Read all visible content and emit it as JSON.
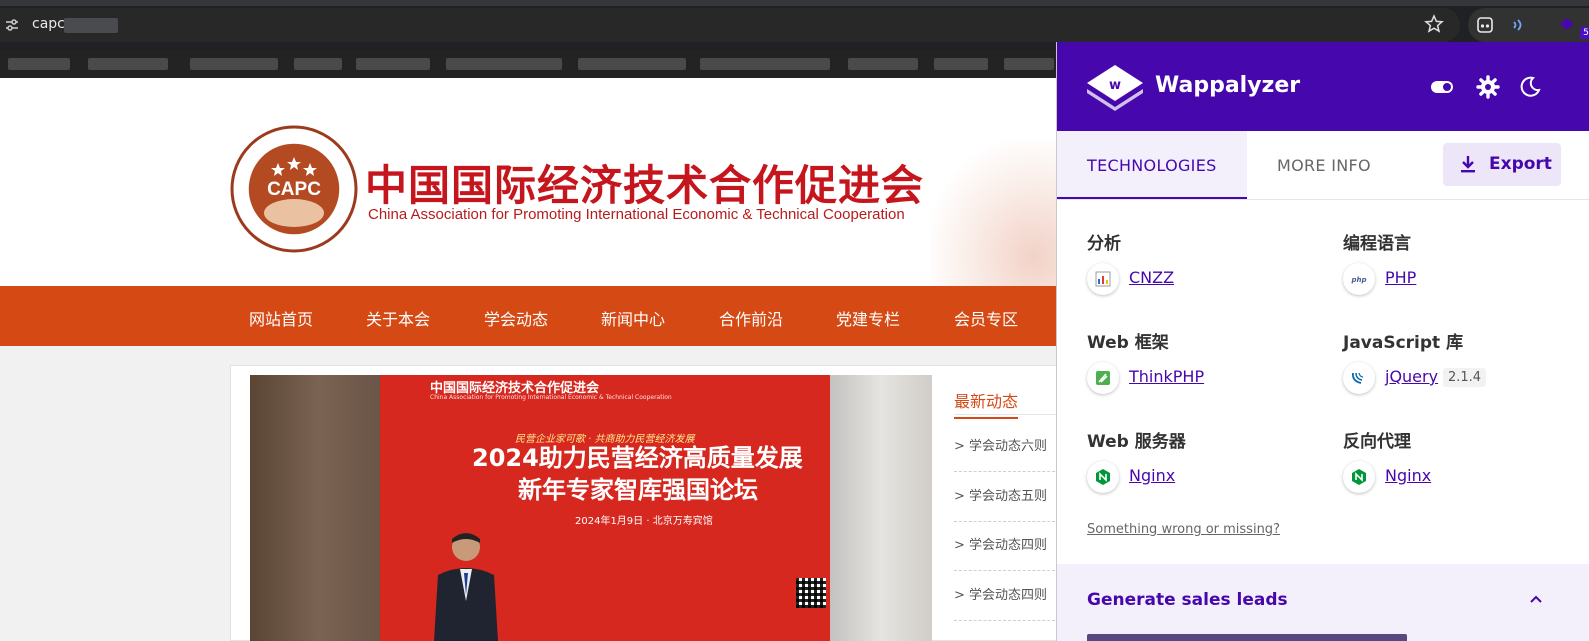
{
  "browser": {
    "url_visible": "capc",
    "extension_badge": "5"
  },
  "site": {
    "title_cn": "中国国际经济技术合作促进会",
    "title_en": "China Association for Promoting International Economic & Technical Cooperation",
    "logo_text": "CAPC",
    "nav": [
      "网站首页",
      "关于本会",
      "学会动态",
      "新闻中心",
      "合作前沿",
      "党建专栏",
      "会员专区"
    ],
    "banner": {
      "org_cn": "中国国际经济技术合作促进会",
      "org_en": "China Association for Promoting International Economic & Technical Cooperation",
      "slogan": "民营企业家可歌 · 共商助力民营经济发展",
      "headline1": "2024助力民营经济高质量发展",
      "headline2": "新年专家智库强国论坛",
      "date": "2024年1月9日 · 北京万寿宾馆"
    },
    "news_title": "最新动态",
    "news_items": [
      "学会动态六则",
      "学会动态五则",
      "学会动态四则",
      "学会动态四则"
    ]
  },
  "wappalyzer": {
    "brand": "Wappalyzer",
    "tabs": {
      "technologies": "TECHNOLOGIES",
      "more_info": "MORE INFO"
    },
    "export_label": "Export",
    "categories": [
      {
        "name": "分析",
        "tech": "CNZZ",
        "icon": "bar-chart-icon"
      },
      {
        "name": "编程语言",
        "tech": "PHP",
        "icon": "php-icon"
      },
      {
        "name": "Web 框架",
        "tech": "ThinkPHP",
        "icon": "thinkphp-icon"
      },
      {
        "name": "JavaScript 库",
        "tech": "jQuery",
        "version": "2.1.4",
        "icon": "jquery-icon"
      },
      {
        "name": "Web 服务器",
        "tech": "Nginx",
        "icon": "nginx-icon"
      },
      {
        "name": "反向代理",
        "tech": "Nginx",
        "icon": "nginx-icon"
      }
    ],
    "wrong_link": "Something wrong or missing?",
    "leads_title": "Generate sales leads"
  },
  "colors": {
    "wappalyzer_purple": "#4608ad",
    "site_nav": "#d54a14",
    "site_red": "#c5161d"
  }
}
